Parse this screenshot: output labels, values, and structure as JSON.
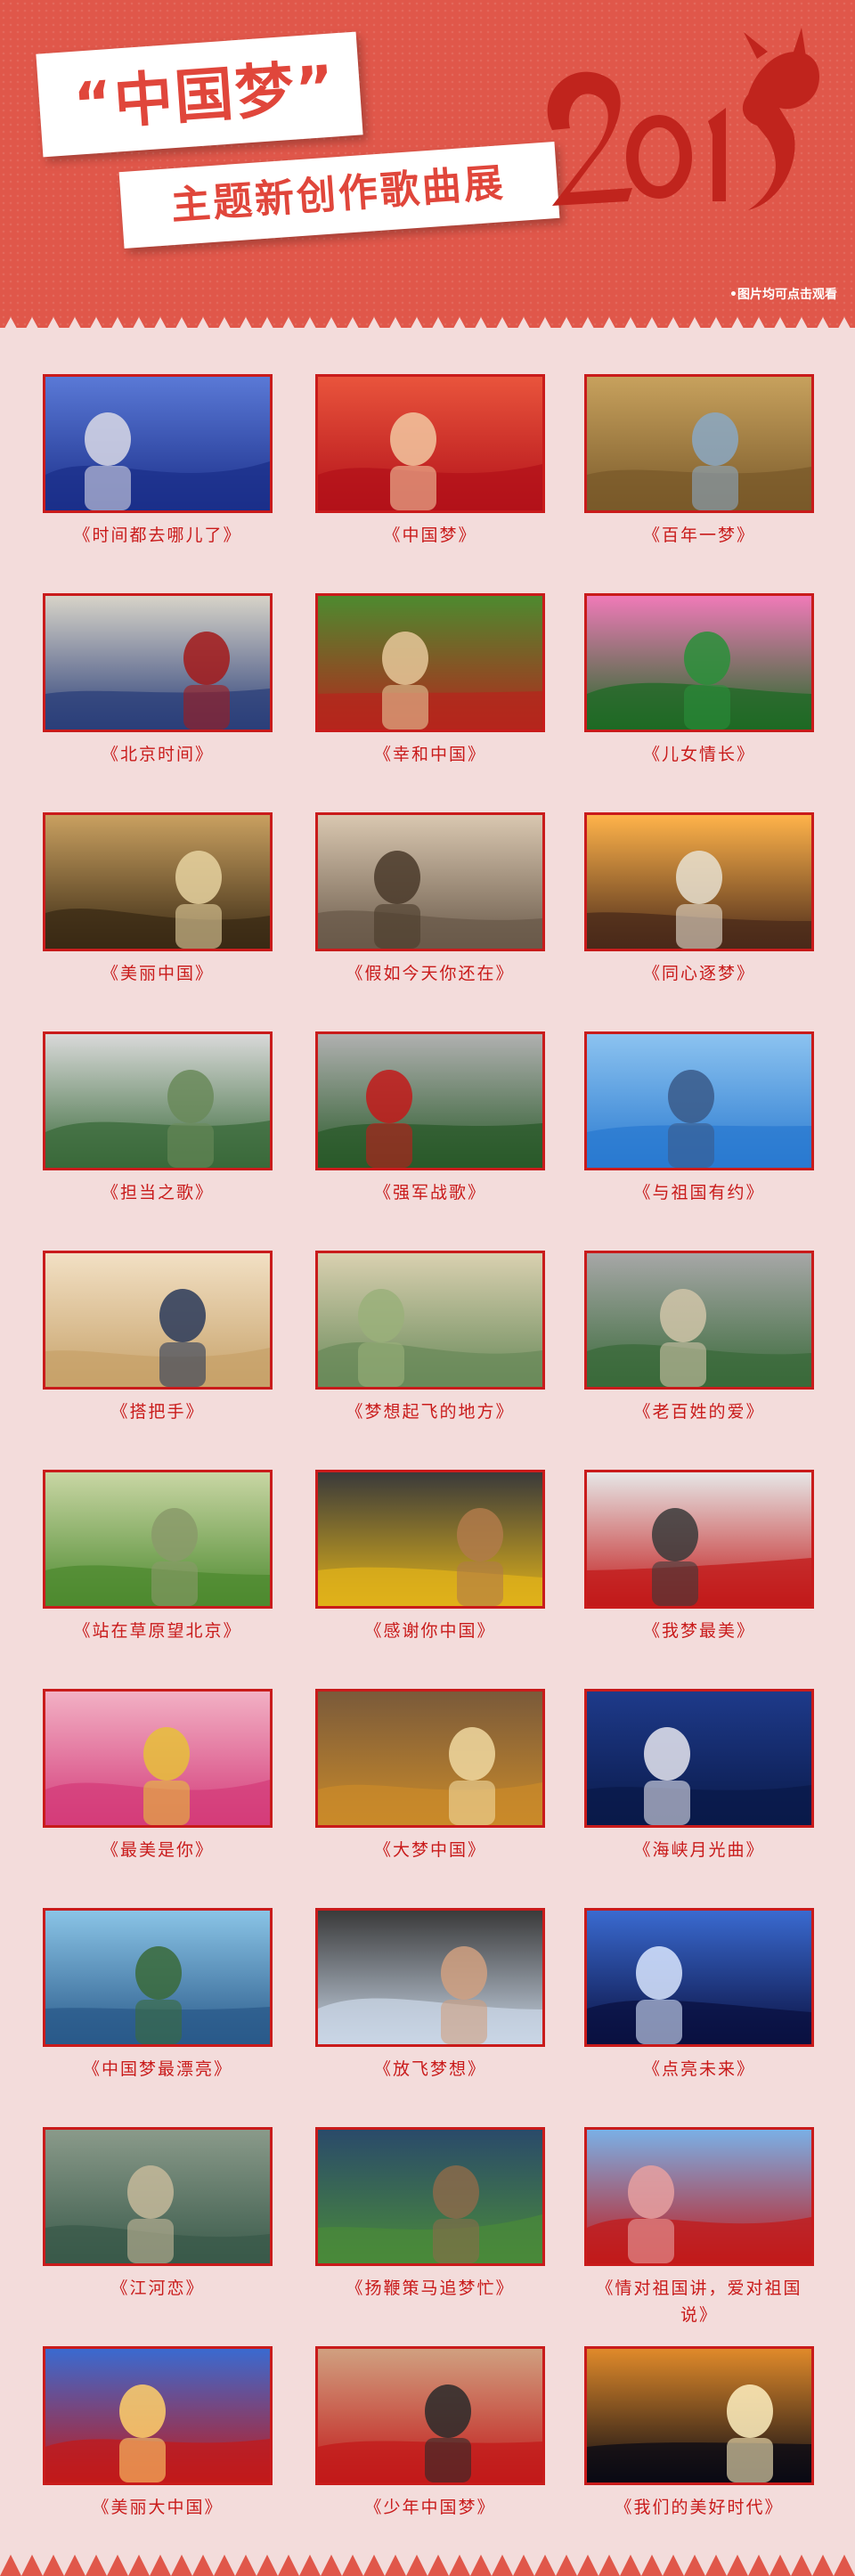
{
  "header": {
    "title": "“中国梦”",
    "subtitle": "主题新创作歌曲展",
    "click_note": "•图片均可点击观看",
    "year_art": "2013",
    "colors": {
      "background": "#e0574a",
      "title_red": "#e0463b",
      "accent": "#c91b1b",
      "page_bg": "#f3dcdb"
    }
  },
  "songs": [
    {
      "title": "《时间都去哪儿了》",
      "icon": "singer-man-glasses-photo"
    },
    {
      "title": "《中国梦》",
      "icon": "singer-woman-red-photo"
    },
    {
      "title": "《百年一梦》",
      "icon": "bronze-lion-palace-photo"
    },
    {
      "title": "《北京时间》",
      "icon": "tiananmen-guards-photo"
    },
    {
      "title": "《幸和中国》",
      "icon": "farmer-flowers-photo"
    },
    {
      "title": "《儿女情长》",
      "icon": "lotus-flower-photo"
    },
    {
      "title": "《美丽中国》",
      "icon": "pagoda-silhouette-photo"
    },
    {
      "title": "《假如今天你还在》",
      "icon": "two-men-cap-photo"
    },
    {
      "title": "《同心逐梦》",
      "icon": "rocket-launch-photo"
    },
    {
      "title": "《担当之歌》",
      "icon": "police-motorcycles-photo"
    },
    {
      "title": "《强军战歌》",
      "icon": "soldiers-parade-photo"
    },
    {
      "title": "《与祖国有约》",
      "icon": "workers-helmets-photo"
    },
    {
      "title": "《搭把手》",
      "icon": "smiling-woman-photo"
    },
    {
      "title": "《梦想起飞的地方》",
      "icon": "river-valley-aerial-photo"
    },
    {
      "title": "《老百姓的爱》",
      "icon": "city-monument-photo"
    },
    {
      "title": "《站在草原望北京》",
      "icon": "grassland-sheep-photo"
    },
    {
      "title": "《感谢你中国》",
      "icon": "miners-smiling-photo"
    },
    {
      "title": "《我梦最美》",
      "icon": "wheelchair-athlete-photo"
    },
    {
      "title": "《最美是你》",
      "icon": "ethnic-dancers-photo"
    },
    {
      "title": "《大梦中国》",
      "icon": "great-wall-photo"
    },
    {
      "title": "《海峡月光曲》",
      "icon": "moon-singer-photo"
    },
    {
      "title": "《中国梦最漂亮》",
      "icon": "lake-mountains-photo"
    },
    {
      "title": "《放飞梦想》",
      "icon": "children-teacher-photo"
    },
    {
      "title": "《点亮未来》",
      "icon": "olympic-rings-photo"
    },
    {
      "title": "《江河恋》",
      "icon": "cliffs-gorge-photo"
    },
    {
      "title": "《扬鞭策马追梦忙》",
      "icon": "horses-grassland-photo"
    },
    {
      "title": "《情对祖国讲，爱对祖国说》",
      "icon": "balloons-crowd-photo"
    },
    {
      "title": "《美丽大中国》",
      "icon": "red-lanterns-photo"
    },
    {
      "title": "《少年中国梦》",
      "icon": "little-girl-photo"
    },
    {
      "title": "《我们的美好时代》",
      "icon": "city-night-highway-photo"
    }
  ]
}
